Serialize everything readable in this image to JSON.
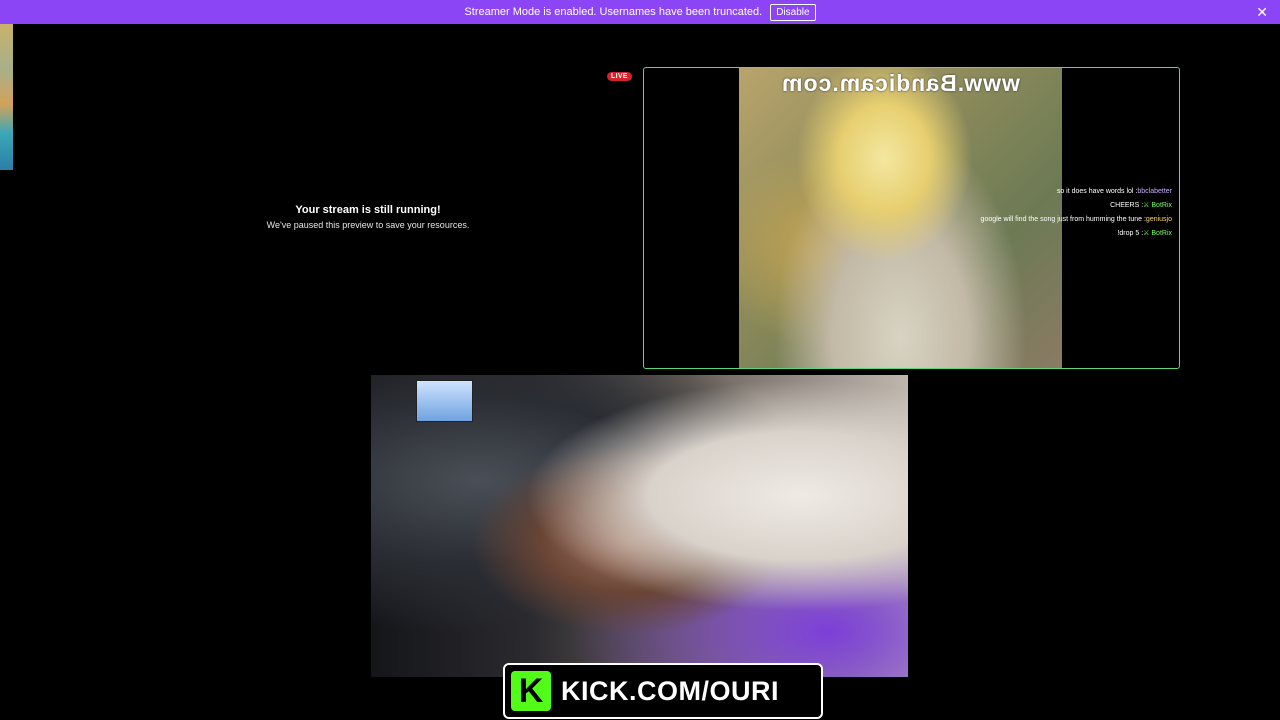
{
  "banner": {
    "text": "Streamer Mode is enabled. Usernames have been truncated.",
    "disable_label": "Disable",
    "close_glyph": "✕",
    "color": "#8b45f5"
  },
  "paused_preview": {
    "title": "Your stream is still running!",
    "subtitle": "We've paused this preview to save your resources."
  },
  "stream": {
    "live_label": "LIVE",
    "watermark": "www.Bandicam.com",
    "border_color": "#57d97b",
    "chat": [
      {
        "user": "bbclabetter",
        "message": "so it does have words lol"
      },
      {
        "user": "⚔ BotRix",
        "message": "CHEERS"
      },
      {
        "user": "geniusjo",
        "message": "google will find the song just from humming the tune"
      },
      {
        "user": "⚔ BotRix",
        "message": "!drop 5"
      }
    ]
  },
  "overlay": {
    "logo_letter": "K",
    "url_text": "KICK.COM/OURI",
    "brand_color": "#53fc18"
  }
}
